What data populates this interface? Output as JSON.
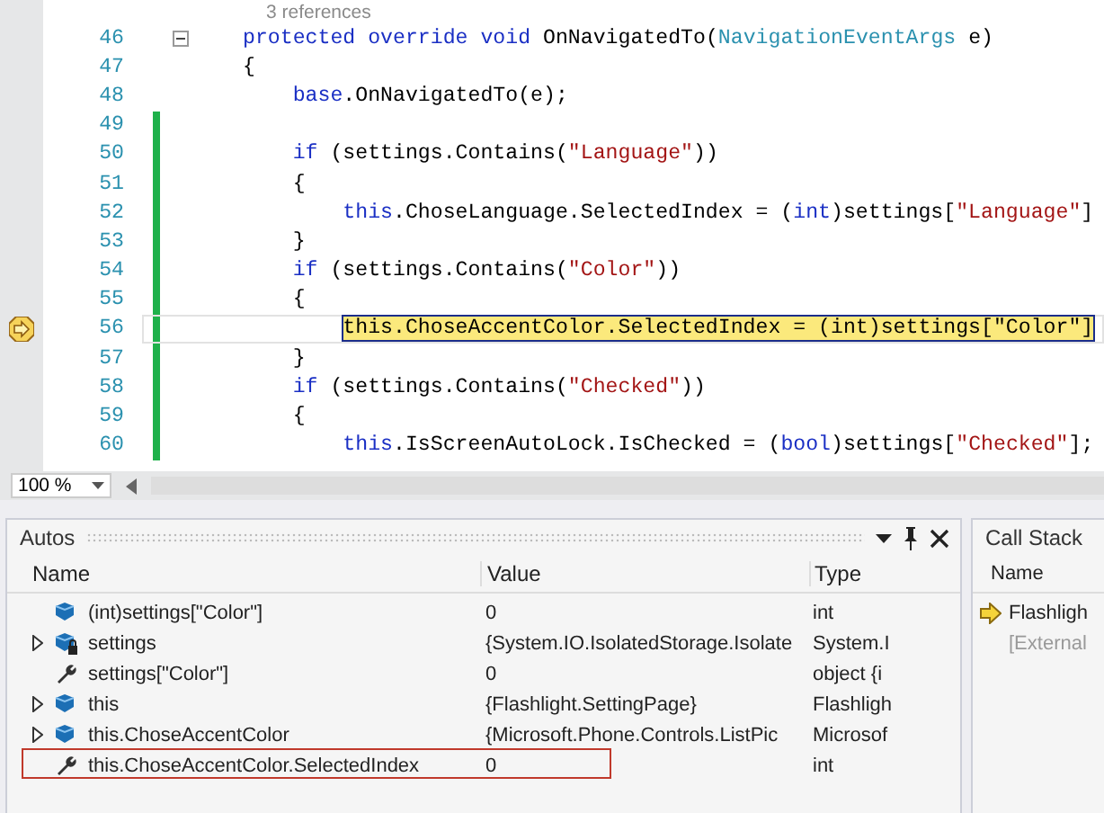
{
  "editor": {
    "codelens": "3 references",
    "lines": [
      {
        "number": "46",
        "collapsible": true,
        "changed": false,
        "current": false,
        "tokens": [
          {
            "kind": "keyword",
            "text": "protected "
          },
          {
            "kind": "keyword",
            "text": "override "
          },
          {
            "kind": "keyword",
            "text": "void"
          },
          {
            "kind": "plain",
            "text": " OnNavigatedTo("
          },
          {
            "kind": "type",
            "text": "NavigationEventArgs"
          },
          {
            "kind": "plain",
            "text": " e)"
          }
        ]
      },
      {
        "number": "47",
        "collapsible": false,
        "changed": false,
        "current": false,
        "tokens": [
          {
            "kind": "plain",
            "text": "{"
          }
        ]
      },
      {
        "number": "48",
        "collapsible": false,
        "changed": false,
        "current": false,
        "tokens": [
          {
            "kind": "keyword",
            "text": "    base"
          },
          {
            "kind": "plain",
            "text": ".OnNavigatedTo(e);"
          }
        ]
      },
      {
        "number": "49",
        "collapsible": false,
        "changed": true,
        "current": false
      },
      {
        "number": "50",
        "collapsible": false,
        "changed": true,
        "current": false,
        "tokens": [
          {
            "kind": "keyword",
            "text": "    if"
          },
          {
            "kind": "plain",
            "text": " (settings.Contains("
          },
          {
            "kind": "string",
            "text": "\"Language\""
          },
          {
            "kind": "plain",
            "text": "))"
          }
        ]
      },
      {
        "number": "51",
        "collapsible": false,
        "changed": true,
        "current": false,
        "tokens": [
          {
            "kind": "plain",
            "text": "    {"
          }
        ]
      },
      {
        "number": "52",
        "collapsible": false,
        "changed": true,
        "current": false,
        "tokens": [
          {
            "kind": "keyword",
            "text": "        this"
          },
          {
            "kind": "plain",
            "text": ".ChoseLanguage.SelectedIndex = ("
          },
          {
            "kind": "keyword",
            "text": "int"
          },
          {
            "kind": "plain",
            "text": ")settings["
          },
          {
            "kind": "string",
            "text": "\"Language\""
          },
          {
            "kind": "plain",
            "text": "]"
          }
        ]
      },
      {
        "number": "53",
        "collapsible": false,
        "changed": true,
        "current": false,
        "tokens": [
          {
            "kind": "plain",
            "text": "    }"
          }
        ]
      },
      {
        "number": "54",
        "collapsible": false,
        "changed": true,
        "current": false,
        "tokens": [
          {
            "kind": "keyword",
            "text": "    if"
          },
          {
            "kind": "plain",
            "text": " (settings.Contains("
          },
          {
            "kind": "string",
            "text": "\"Color\""
          },
          {
            "kind": "plain",
            "text": "))"
          }
        ]
      },
      {
        "number": "55",
        "collapsible": false,
        "changed": true,
        "current": false,
        "tokens": [
          {
            "kind": "plain",
            "text": "    {"
          }
        ]
      },
      {
        "number": "56",
        "collapsible": false,
        "changed": true,
        "current": true,
        "tokens": [
          {
            "kind": "plain",
            "text": "this.ChoseAccentColor.SelectedIndex = (int)settings[\"Color\"]"
          }
        ]
      },
      {
        "number": "57",
        "collapsible": false,
        "changed": true,
        "current": false,
        "tokens": [
          {
            "kind": "plain",
            "text": "    }"
          }
        ]
      },
      {
        "number": "58",
        "collapsible": false,
        "changed": true,
        "current": false,
        "tokens": [
          {
            "kind": "keyword",
            "text": "    if"
          },
          {
            "kind": "plain",
            "text": " (settings.Contains("
          },
          {
            "kind": "string",
            "text": "\"Checked\""
          },
          {
            "kind": "plain",
            "text": "))"
          }
        ]
      },
      {
        "number": "59",
        "collapsible": false,
        "changed": true,
        "current": false,
        "tokens": [
          {
            "kind": "plain",
            "text": "    {"
          }
        ]
      },
      {
        "number": "60",
        "collapsible": false,
        "changed": true,
        "current": false,
        "tokens": [
          {
            "kind": "keyword",
            "text": "        this"
          },
          {
            "kind": "plain",
            "text": ".IsScreenAutoLock.IsChecked = ("
          },
          {
            "kind": "keyword",
            "text": "bool"
          },
          {
            "kind": "plain",
            "text": ")settings["
          },
          {
            "kind": "string",
            "text": "\"Checked\""
          },
          {
            "kind": "plain",
            "text": "];"
          }
        ]
      }
    ],
    "zoom": "100 %"
  },
  "autos": {
    "title": "Autos",
    "columns": [
      "Name",
      "Value",
      "Type"
    ],
    "rows": [
      {
        "kind": "field",
        "expandable": false,
        "highlighted": false,
        "name": "(int)settings[\"Color\"]",
        "value": "0",
        "type": "int"
      },
      {
        "kind": "locked",
        "expandable": true,
        "highlighted": false,
        "name": "settings",
        "value": "{System.IO.IsolatedStorage.Isolate",
        "type": "System.I"
      },
      {
        "kind": "property",
        "expandable": false,
        "highlighted": false,
        "name": "settings[\"Color\"]",
        "value": "0",
        "type": "object {i"
      },
      {
        "kind": "field",
        "expandable": true,
        "highlighted": false,
        "name": "this",
        "value": "{Flashlight.SettingPage}",
        "type": "Flashligh"
      },
      {
        "kind": "field",
        "expandable": true,
        "highlighted": false,
        "name": "this.ChoseAccentColor",
        "value": "{Microsoft.Phone.Controls.ListPic",
        "type": "Microsof"
      },
      {
        "kind": "property",
        "expandable": false,
        "highlighted": true,
        "name": "this.ChoseAccentColor.SelectedIndex",
        "value": "0",
        "type": "int"
      }
    ]
  },
  "call_stack": {
    "title": "Call Stack",
    "columns": [
      "Name"
    ],
    "rows": [
      {
        "current": true,
        "name": "Flashligh"
      },
      {
        "current": false,
        "name": "[External"
      }
    ]
  }
}
